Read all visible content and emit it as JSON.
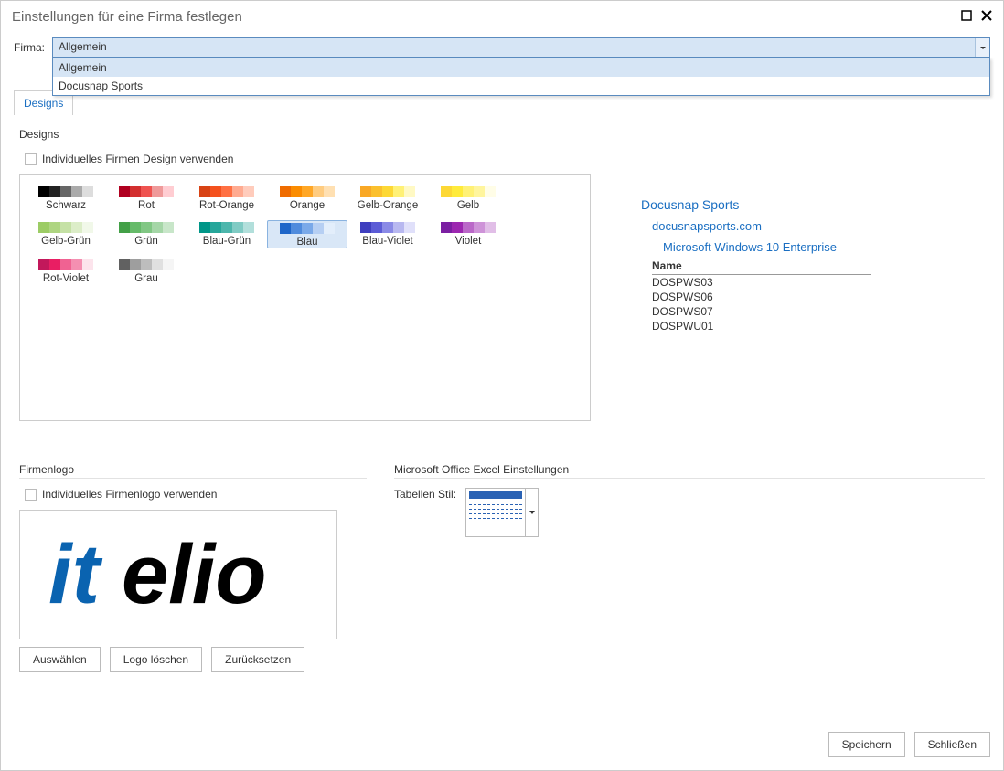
{
  "window": {
    "title": "Einstellungen für eine Firma festlegen"
  },
  "firma": {
    "label": "Firma:",
    "value": "Allgemein",
    "options": [
      "Allgemein",
      "Docusnap Sports"
    ]
  },
  "tabs": {
    "design": "Designs"
  },
  "designs": {
    "section_title": "Designs",
    "use_individual_label": "Individuelles Firmen Design verwenden",
    "palette": [
      {
        "name": "Schwarz",
        "colors": [
          "#000000",
          "#222222",
          "#666666",
          "#aaaaaa",
          "#dddddd"
        ]
      },
      {
        "name": "Rot",
        "colors": [
          "#b00020",
          "#d32f2f",
          "#ef5350",
          "#ef9a9a",
          "#ffcdd2"
        ]
      },
      {
        "name": "Rot-Orange",
        "colors": [
          "#d84315",
          "#f4511e",
          "#ff7043",
          "#ffab91",
          "#ffccbc"
        ]
      },
      {
        "name": "Orange",
        "colors": [
          "#ef6c00",
          "#fb8c00",
          "#ffa726",
          "#ffcc80",
          "#ffe0b2"
        ]
      },
      {
        "name": "Gelb-Orange",
        "colors": [
          "#f9a825",
          "#fbc02d",
          "#fdd835",
          "#fff176",
          "#fff9c4"
        ]
      },
      {
        "name": "Gelb",
        "colors": [
          "#fdd835",
          "#ffeb3b",
          "#fff176",
          "#fff59d",
          "#fffde7"
        ]
      },
      {
        "name": "Gelb-Grün",
        "colors": [
          "#9ccc65",
          "#aed581",
          "#c5e1a5",
          "#dcedc8",
          "#f1f8e9"
        ]
      },
      {
        "name": "Grün",
        "colors": [
          "#43a047",
          "#66bb6a",
          "#81c784",
          "#a5d6a7",
          "#c8e6c9"
        ]
      },
      {
        "name": "Blau-Grün",
        "colors": [
          "#009688",
          "#26a69a",
          "#4db6ac",
          "#80cbc4",
          "#b2dfdb"
        ]
      },
      {
        "name": "Blau",
        "colors": [
          "#1e66c9",
          "#4f8bdd",
          "#7aa9e9",
          "#b6cff3",
          "#e3eefb"
        ],
        "selected": true
      },
      {
        "name": "Blau-Violet",
        "colors": [
          "#3f3fbf",
          "#5c5cd6",
          "#8a8ae6",
          "#b8b8f0",
          "#e0e0fa"
        ]
      },
      {
        "name": "Violet",
        "colors": [
          "#7b1fa2",
          "#9c27b0",
          "#ba68c8",
          "#ce93d8",
          "#e1bee7"
        ]
      },
      {
        "name": "Rot-Violet",
        "colors": [
          "#c2185b",
          "#e91e63",
          "#f06292",
          "#f48fb1",
          "#fce4ec"
        ]
      },
      {
        "name": "Grau",
        "colors": [
          "#616161",
          "#9e9e9e",
          "#bdbdbd",
          "#e0e0e0",
          "#f5f5f5"
        ]
      }
    ]
  },
  "preview": {
    "lvl1": "Docusnap Sports",
    "lvl2": "docusnapsports.com",
    "lvl3": "Microsoft Windows 10 Enterprise",
    "table_header": "Name",
    "rows": [
      "DOSPWS03",
      "DOSPWS06",
      "DOSPWS07",
      "DOSPWU01"
    ]
  },
  "logo": {
    "section_title": "Firmenlogo",
    "use_individual_label": "Individuelles Firmenlogo verwenden",
    "buttons": {
      "choose": "Auswählen",
      "delete": "Logo löschen",
      "reset": "Zurücksetzen"
    }
  },
  "excel": {
    "section_title": "Microsoft Office Excel Einstellungen",
    "style_label": "Tabellen Stil:"
  },
  "footer": {
    "save": "Speichern",
    "close": "Schließen"
  }
}
